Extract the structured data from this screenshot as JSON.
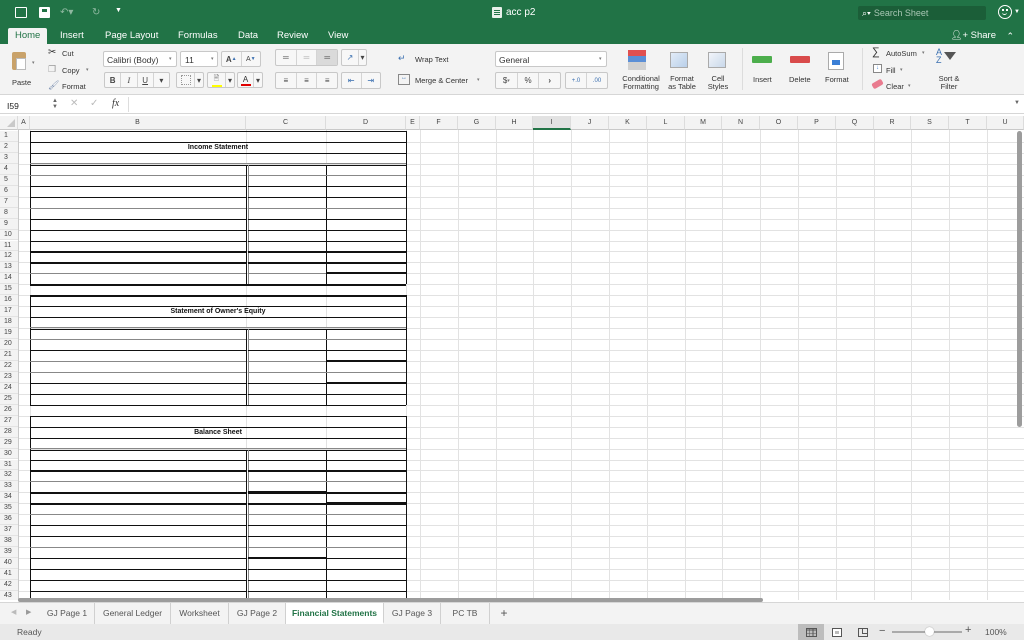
{
  "titlebar": {
    "document_title": "acc p2",
    "search_placeholder": "Search Sheet",
    "quick_access": [
      "sidebar-icon",
      "save-icon",
      "undo-icon",
      "redo-icon",
      "customize-icon"
    ]
  },
  "ribbon_tabs": [
    {
      "label": "Home",
      "active": true
    },
    {
      "label": "Insert"
    },
    {
      "label": "Page Layout"
    },
    {
      "label": "Formulas"
    },
    {
      "label": "Data"
    },
    {
      "label": "Review"
    },
    {
      "label": "View"
    }
  ],
  "share_label": "Share",
  "clipboard": {
    "paste": "Paste",
    "cut": "Cut",
    "copy": "Copy",
    "format": "Format"
  },
  "font": {
    "name": "Calibri (Body)",
    "size": "11",
    "bold": "B",
    "italic": "I",
    "underline": "U",
    "grow": "A",
    "shrink": "A",
    "font_color": "A"
  },
  "colors": {
    "highlight": "#ffff00",
    "font_color": "#e00000",
    "accent": "#217346"
  },
  "alignment": {
    "wrap_text": "Wrap Text",
    "merge_center": "Merge & Center"
  },
  "number": {
    "format": "General",
    "currency": "$",
    "percent": "%",
    "comma": "›",
    "inc_decimal": "+.0",
    "dec_decimal": ".00"
  },
  "styles": {
    "conditional": [
      "Conditional",
      "Formatting"
    ],
    "format_table": [
      "Format",
      "as Table"
    ],
    "cell_styles": [
      "Cell",
      "Styles"
    ]
  },
  "cells": {
    "insert": "Insert",
    "delete": "Delete",
    "format": "Format"
  },
  "editing": {
    "autosum": "AutoSum",
    "fill": "Fill",
    "clear": "Clear",
    "sort": [
      "Sort &",
      "Filter"
    ]
  },
  "formula_bar": {
    "name_box": "I59",
    "fx": "fx",
    "formula": ""
  },
  "columns": [
    "A",
    "B",
    "C",
    "D",
    "E",
    "F",
    "G",
    "H",
    "I",
    "J",
    "K",
    "L",
    "M",
    "N",
    "O",
    "P",
    "Q",
    "R",
    "S",
    "T",
    "U"
  ],
  "selected_column": "I",
  "rows": [
    "1",
    "2",
    "3",
    "4",
    "5",
    "6",
    "7",
    "8",
    "9",
    "10",
    "11",
    "12",
    "13",
    "14",
    "15",
    "16",
    "17",
    "18",
    "19",
    "20",
    "21",
    "22",
    "23",
    "24",
    "25",
    "26",
    "27",
    "28",
    "29",
    "30",
    "31",
    "32",
    "33",
    "34",
    "35",
    "36",
    "37",
    "38",
    "39",
    "40",
    "41",
    "42",
    "43"
  ],
  "sections": [
    {
      "title": "Income Statement",
      "title_row": 2
    },
    {
      "title": "Statement of Owner's Equity",
      "title_row": 17
    },
    {
      "title": "Balance Sheet",
      "title_row": 28
    }
  ],
  "sheet_tabs": [
    {
      "label": "GJ Page 1"
    },
    {
      "label": "General Ledger"
    },
    {
      "label": "Worksheet"
    },
    {
      "label": "GJ Page 2"
    },
    {
      "label": "Financial Statements",
      "active": true
    },
    {
      "label": "GJ Page 3"
    },
    {
      "label": "PC TB"
    }
  ],
  "add_sheet": "+",
  "status": {
    "text": "Ready",
    "zoom": "100%",
    "zoom_minus": "−",
    "zoom_plus": "+"
  }
}
